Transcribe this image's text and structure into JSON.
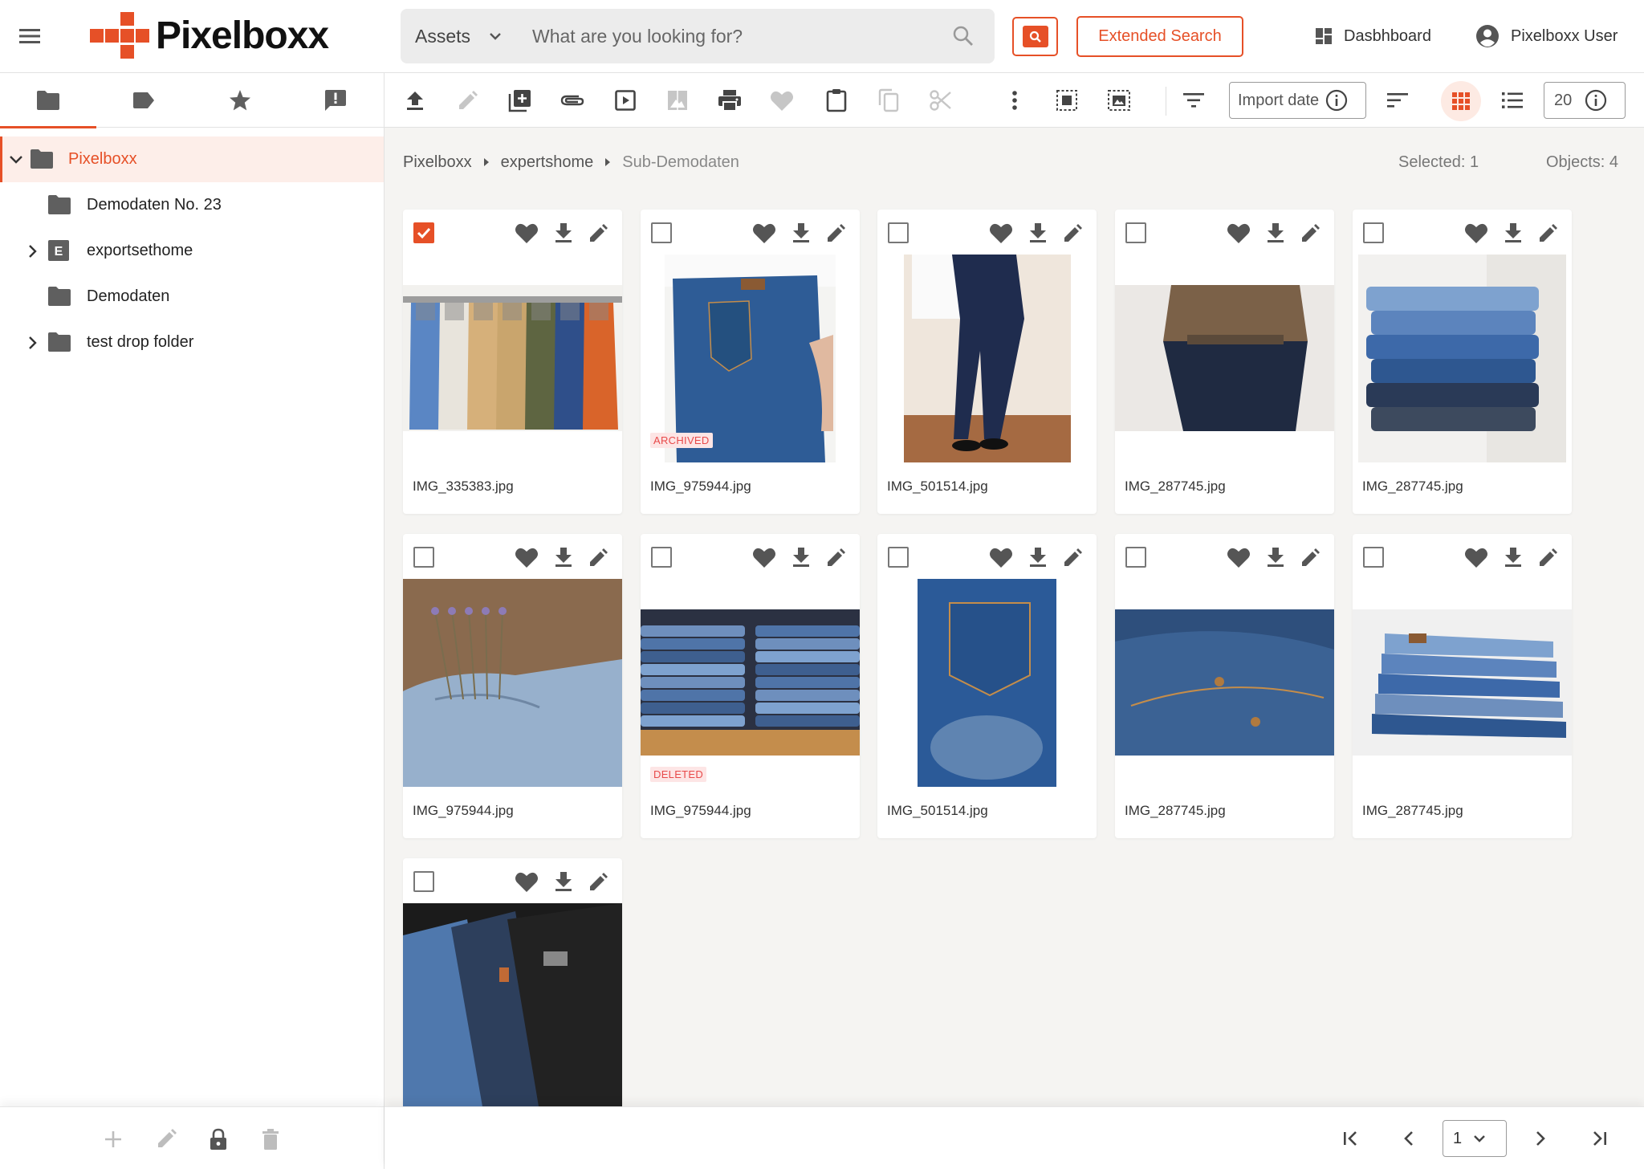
{
  "header": {
    "logo_text": "Pixelboxx",
    "search_scope": "Assets",
    "search_placeholder": "What are you looking for?",
    "extended_search_label": "Extended Search",
    "dashboard_label": "Dasbhboard",
    "user_label": "Pixelboxx User",
    "accent_color": "#e65027"
  },
  "sidebar": {
    "tabs": [
      "folders",
      "tags",
      "favorites",
      "notifications"
    ],
    "tree": [
      {
        "label": "Pixelboxx",
        "active": true,
        "expanded": true,
        "icon": "folder-icon"
      },
      {
        "label": "Demodaten No. 23",
        "icon": "folder-icon"
      },
      {
        "label": "exportsethome",
        "expandable": true,
        "icon": "export-folder-icon",
        "icon_letter": "E"
      },
      {
        "label": "Demodaten",
        "icon": "folder-icon"
      },
      {
        "label": "test drop folder",
        "expandable": true,
        "icon": "folder-icon"
      }
    ]
  },
  "toolbar": {
    "sort_label": "Import date",
    "page_size": "20"
  },
  "breadcrumb": {
    "items": [
      "Pixelboxx",
      "expertshome",
      "Sub-Demodaten"
    ]
  },
  "status": {
    "selected": "Selected: 1",
    "objects": "Objects: 4"
  },
  "assets": [
    {
      "file": "IMG_335383.jpg",
      "checked": true,
      "badge": ""
    },
    {
      "file": "IMG_975944.jpg",
      "checked": false,
      "badge": "ARCHIVED"
    },
    {
      "file": "IMG_501514.jpg",
      "checked": false,
      "badge": ""
    },
    {
      "file": "IMG_287745.jpg",
      "checked": false,
      "badge": ""
    },
    {
      "file": "IMG_287745.jpg",
      "checked": false,
      "badge": ""
    },
    {
      "file": "IMG_975944.jpg",
      "checked": false,
      "badge": ""
    },
    {
      "file": "IMG_975944.jpg",
      "checked": false,
      "badge": "DELETED"
    },
    {
      "file": "IMG_501514.jpg",
      "checked": false,
      "badge": ""
    },
    {
      "file": "IMG_287745.jpg",
      "checked": false,
      "badge": ""
    },
    {
      "file": "IMG_287745.jpg",
      "checked": false,
      "badge": ""
    },
    {
      "file": "",
      "checked": false,
      "badge": ""
    }
  ],
  "pagination": {
    "current_page": "1"
  }
}
